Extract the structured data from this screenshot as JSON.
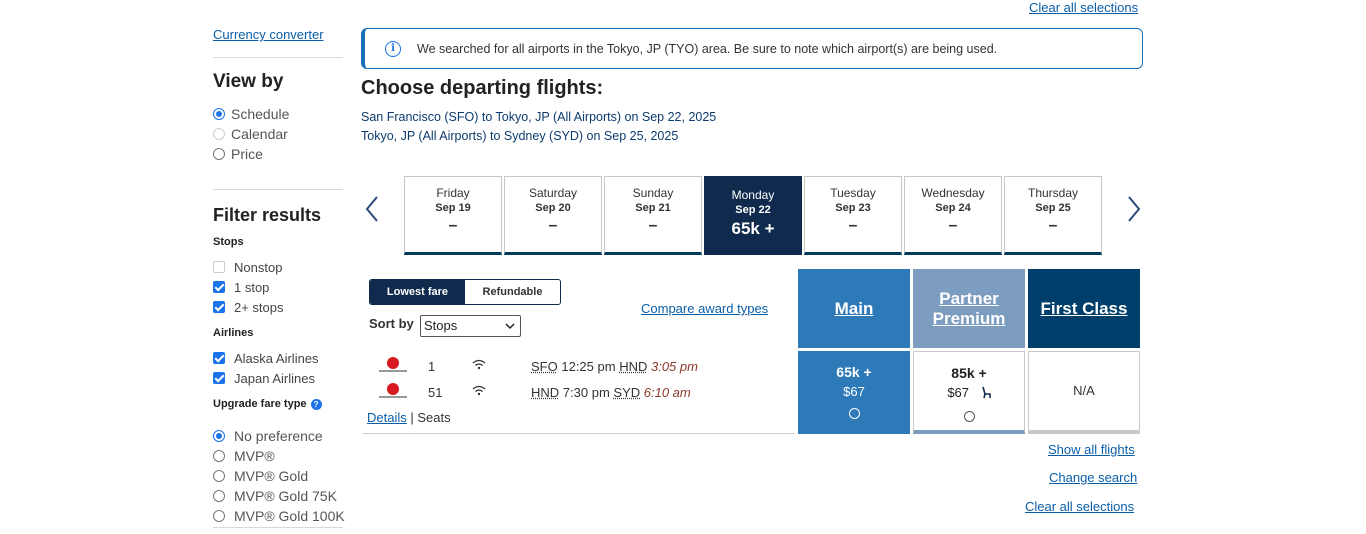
{
  "sidebar": {
    "currency_link": "Currency converter",
    "view_by": {
      "title": "View by",
      "options": [
        "Schedule",
        "Calendar",
        "Price"
      ],
      "selected": "Schedule"
    },
    "filter": {
      "title": "Filter results",
      "stops_label": "Stops",
      "stops": [
        {
          "label": "Nonstop",
          "checked": false
        },
        {
          "label": "1 stop",
          "checked": true
        },
        {
          "label": "2+ stops",
          "checked": true
        }
      ],
      "airlines_label": "Airlines",
      "airlines": [
        {
          "label": "Alaska Airlines",
          "checked": true
        },
        {
          "label": "Japan Airlines",
          "checked": true
        }
      ],
      "upgrade_label": "Upgrade fare type",
      "upgrade_help": "?",
      "upgrade_options": [
        "No preference",
        "MVP®",
        "MVP® Gold",
        "MVP® Gold 75K",
        "MVP® Gold 100K"
      ]
    }
  },
  "main": {
    "clear_top": "Clear all selections",
    "info_icon": "i",
    "info_text": "We searched for all airports in the Tokyo, JP (TYO) area. Be sure to note which airport(s) are being used.",
    "title": "Choose departing flights:",
    "routes": [
      "San Francisco (SFO) to Tokyo, JP (All Airports) on Sep 22, 2025",
      "Tokyo, JP (All Airports) to Sydney (SYD) on Sep 25, 2025"
    ],
    "prev_arrow": "‹",
    "next_arrow": "›",
    "dates": [
      {
        "dow": "Friday",
        "date": "Sep 19",
        "price": "–"
      },
      {
        "dow": "Saturday",
        "date": "Sep 20",
        "price": "–"
      },
      {
        "dow": "Sunday",
        "date": "Sep 21",
        "price": "–"
      },
      {
        "dow": "Monday",
        "date": "Sep 22",
        "price": "65k +"
      },
      {
        "dow": "Tuesday",
        "date": "Sep 23",
        "price": "–"
      },
      {
        "dow": "Wednesday",
        "date": "Sep 24",
        "price": "–"
      },
      {
        "dow": "Thursday",
        "date": "Sep 25",
        "price": "–"
      }
    ],
    "toggle": {
      "lowest": "Lowest fare",
      "refundable": "Refundable"
    },
    "sort_label": "Sort by",
    "sort_value": "Stops",
    "compare_link": "Compare award types",
    "fare_headers": {
      "main": "Main",
      "partner_premium_1": "Partner",
      "partner_premium_2": "Premium",
      "first": "First Class"
    },
    "colors": {
      "main": "#2e7ab8",
      "partner": "#7c9dc0",
      "first": "#003f6b",
      "selected_tab": "#0f2a4d"
    },
    "flights": [
      {
        "number": "1",
        "from": "SFO",
        "dep": "12:25 pm",
        "to": "HND",
        "arr": "3:05 pm"
      },
      {
        "number": "51",
        "from": "HND",
        "dep": "7:30 pm",
        "to": "SYD",
        "arr": "6:10 am"
      }
    ],
    "details_link": "Details",
    "divider": "|",
    "seats_text": "Seats",
    "fares": {
      "main": {
        "points": "65k +",
        "usd": "$67"
      },
      "partner": {
        "points": "85k +",
        "usd": "$67"
      },
      "first": {
        "na": "N/A"
      }
    },
    "bottom_links": {
      "show_all": "Show all flights",
      "change_search": "Change search",
      "clear_all": "Clear all selections"
    }
  }
}
